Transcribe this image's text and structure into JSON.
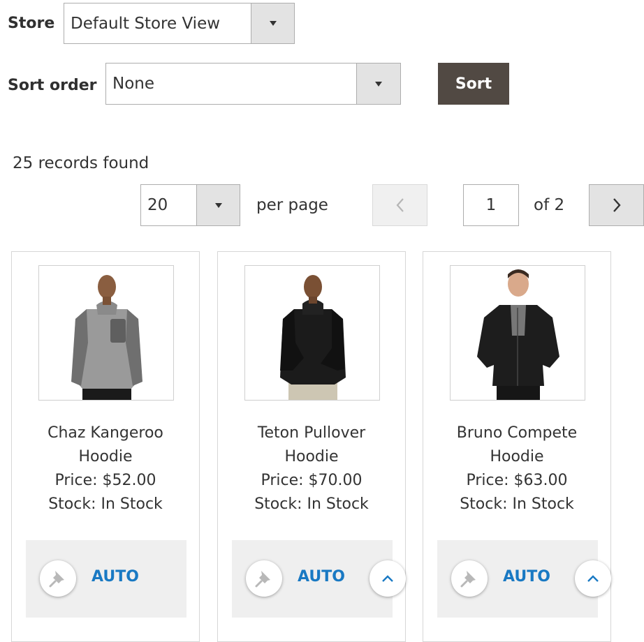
{
  "store": {
    "label": "Store",
    "selected": "Default Store View"
  },
  "sort": {
    "label": "Sort order",
    "selected": "None",
    "button_label": "Sort"
  },
  "records": {
    "found_text": "25 records found"
  },
  "pager": {
    "per_page_value": "20",
    "per_page_label": "per page",
    "current_page": "1",
    "of_label": "of 2"
  },
  "products": [
    {
      "name_line1": "Chaz Kangeroo",
      "name_line2": "Hoodie",
      "price": "Price: $52.00",
      "stock": "Stock: In Stock",
      "action_label": "AUTO"
    },
    {
      "name_line1": "Teton Pullover",
      "name_line2": "Hoodie",
      "price": "Price: $70.00",
      "stock": "Stock: In Stock",
      "action_label": "AUTO"
    },
    {
      "name_line1": "Bruno Compete",
      "name_line2": "Hoodie",
      "price": "Price: $63.00",
      "stock": "Stock: In Stock",
      "action_label": "AUTO"
    }
  ],
  "icons": {
    "dropdown": "chevron-down-icon",
    "prev": "chevron-left-icon",
    "next": "chevron-right-icon",
    "pin": "pin-icon",
    "move_up": "chevron-up-icon"
  },
  "colors": {
    "sort_button": "#514943",
    "action_text": "#1979c3",
    "action_panel": "#efefef",
    "select_arrow_bg": "#e3e3e3"
  }
}
